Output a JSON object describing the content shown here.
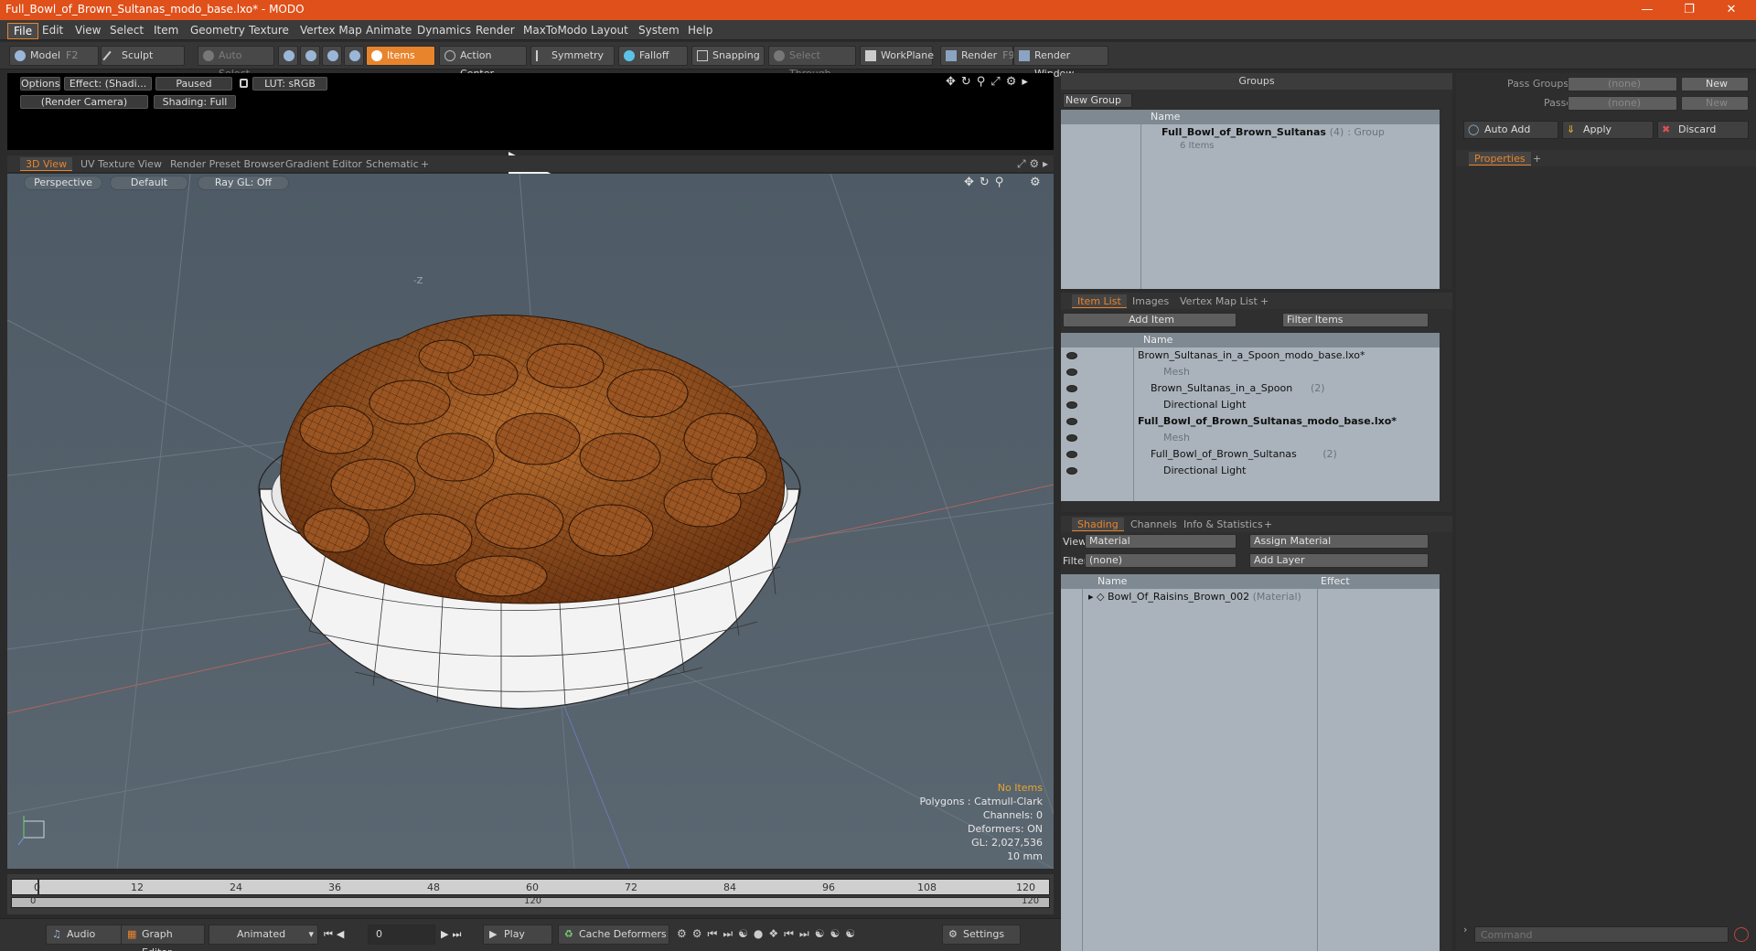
{
  "window": {
    "title": "Full_Bowl_of_Brown_Sultanas_modo_base.lxo* - MODO"
  },
  "menu": [
    "File",
    "Edit",
    "View",
    "Select",
    "Item",
    "Geometry",
    "Texture",
    "Vertex Map",
    "Animate",
    "Dynamics",
    "Render",
    "MaxToModo",
    "Layout",
    "System",
    "Help"
  ],
  "toolbar": {
    "model": "Model",
    "model_key": "F2",
    "sculpt": "Sculpt",
    "auto_select": "Auto Select",
    "items": "Items",
    "action_center": "Action Center",
    "symmetry": "Symmetry",
    "falloff": "Falloff",
    "snapping": "Snapping",
    "select_through": "Select Through",
    "workplane": "WorkPlane",
    "render": "Render",
    "render_key": "F9",
    "render_window": "Render Window"
  },
  "preview": {
    "options": "Options",
    "effect": "Effect: (Shadi...",
    "paused": "Paused",
    "lut": "LUT: sRGB",
    "camera": "(Render Camera)",
    "shading": "Shading: Full"
  },
  "view_tabs": [
    "3D View",
    "UV Texture View",
    "Render Preset Browser",
    "Gradient Editor",
    "Schematic",
    "+"
  ],
  "viewport": {
    "projection": "Perspective",
    "style": "Default",
    "raygl": "Ray GL: Off",
    "axis_label": "-Z",
    "hud": {
      "no_items": "No Items",
      "polygons": "Polygons : Catmull-Clark",
      "channels": "Channels: 0",
      "deformers": "Deformers: ON",
      "gl": "GL: 2,027,536",
      "scale": "10 mm"
    }
  },
  "timeline": {
    "ticks": [
      "0",
      "12",
      "24",
      "36",
      "48",
      "60",
      "72",
      "84",
      "96",
      "108",
      "120"
    ],
    "start": "0",
    "mid": "120",
    "end": "120"
  },
  "bottom": {
    "audio": "Audio",
    "graph_editor": "Graph Editor",
    "animated": "Animated",
    "frame": "0",
    "play": "Play",
    "cache": "Cache Deformers",
    "settings": "Settings"
  },
  "groups": {
    "title": "Groups",
    "new_group": "New Group",
    "col_name": "Name",
    "item_name": "Full_Bowl_of_Brown_Sultanas",
    "item_count": "(4)",
    "item_type": ": Group",
    "item_sub": "6 Items"
  },
  "item_list": {
    "tabs": [
      "Item List",
      "Images",
      "Vertex Map List",
      "+"
    ],
    "add_item": "Add Item",
    "filter": "Filter Items",
    "col_name": "Name",
    "rows": [
      {
        "label": "Brown_Sultanas_in_a_Spoon_modo_base.lxo*",
        "suffix": "",
        "bold": false,
        "level": 0,
        "dim": false
      },
      {
        "label": "Mesh",
        "suffix": "",
        "bold": false,
        "level": 2,
        "dim": true
      },
      {
        "label": "Brown_Sultanas_in_a_Spoon",
        "suffix": "(2)",
        "bold": false,
        "level": 1,
        "dim": false
      },
      {
        "label": "Directional Light",
        "suffix": "",
        "bold": false,
        "level": 2,
        "dim": false
      },
      {
        "label": "Full_Bowl_of_Brown_Sultanas_modo_base.lxo*",
        "suffix": "",
        "bold": true,
        "level": 0,
        "dim": false
      },
      {
        "label": "Mesh",
        "suffix": "",
        "bold": false,
        "level": 2,
        "dim": true
      },
      {
        "label": "Full_Bowl_of_Brown_Sultanas",
        "suffix": "(2)",
        "bold": false,
        "level": 1,
        "dim": false
      },
      {
        "label": "Directional Light",
        "suffix": "",
        "bold": false,
        "level": 2,
        "dim": false
      }
    ]
  },
  "shading": {
    "tabs": [
      "Shading",
      "Channels",
      "Info & Statistics",
      "+"
    ],
    "view_label": "View",
    "view_value": "Material",
    "assign": "Assign Material",
    "filter_label": "Filter",
    "filter_value": "(none)",
    "add_layer": "Add Layer",
    "col_name": "Name",
    "col_effect": "Effect",
    "material": "Bowl_Of_Raisins_Brown_002",
    "material_type": "(Material)"
  },
  "properties": {
    "pass_groups": "Pass Groups",
    "passes": "Passes",
    "none": "(none)",
    "new": "New",
    "auto_add": "Auto Add",
    "apply": "Apply",
    "discard": "Discard",
    "tab": "Properties",
    "command_placeholder": "Command"
  },
  "colors": {
    "accent": "#e8842c",
    "title_bar": "#e0501a",
    "viewport": "#56626c",
    "raisin": "#8a4a1c"
  }
}
